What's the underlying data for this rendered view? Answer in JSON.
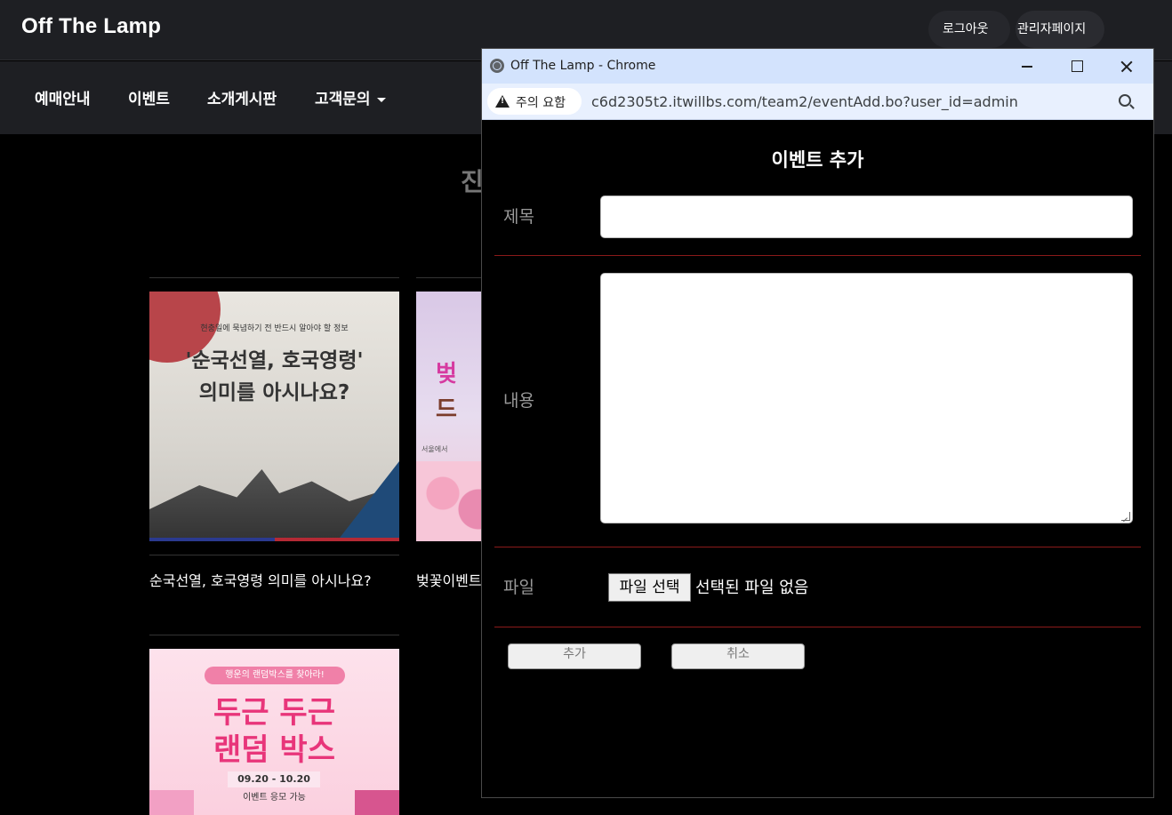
{
  "site": {
    "brand": "Off The Lamp",
    "top_buttons": {
      "logout": "로그아웃",
      "admin": "관리자페이지"
    },
    "nav": [
      "예매안내",
      "이벤트",
      "소개게시판",
      "고객문의"
    ],
    "page_heading": "진"
  },
  "cards": [
    {
      "title": "순국선열, 호국영령 의미를 아시나요?",
      "image": {
        "subtitle": "현충일에 묵념하기 전 반드시 알아야 할 정보",
        "line1": "'순국선열, 호국영령'",
        "line2": "의미를 아시나요?"
      }
    },
    {
      "title": "벚꽃이벤트",
      "image": {
        "char1": "벚",
        "char2": "드",
        "mini": "서울에서"
      }
    },
    {
      "title": "",
      "image": {
        "pill": "행운의 랜덤박스를 찾아라!",
        "line1": "두근 두근",
        "line2": "랜덤 박스",
        "date": "09.20 - 10.20",
        "note": "이벤트 응모 가능"
      }
    }
  ],
  "popup": {
    "window_title": "Off The Lamp - Chrome",
    "warning_chip": "주의 요함",
    "url": "c6d2305t2.itwillbs.com/team2/eventAdd.bo?user_id=admin",
    "form": {
      "heading": "이벤트 추가",
      "title_label": "제목",
      "title_value": "",
      "content_label": "내용",
      "content_value": "",
      "file_label": "파일",
      "file_button": "파일 선택",
      "file_status": "선택된 파일 없음",
      "add_button": "추가",
      "cancel_button": "취소"
    }
  }
}
